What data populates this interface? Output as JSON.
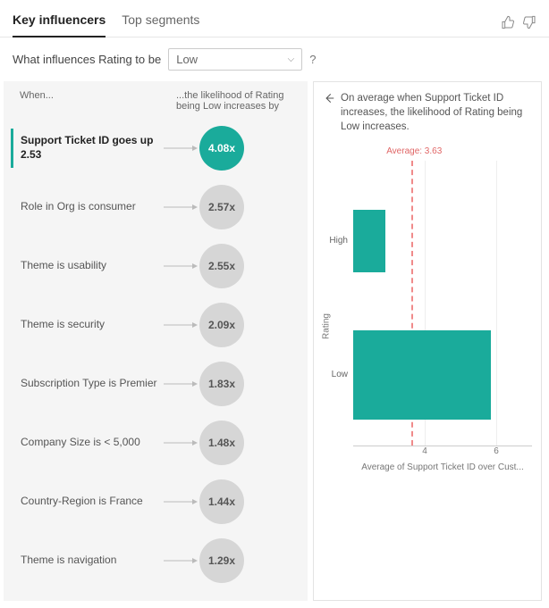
{
  "tabs": {
    "key_influencers": "Key influencers",
    "top_segments": "Top segments"
  },
  "question": {
    "prefix": "What influences Rating to be",
    "dropdown_value": "Low",
    "help": "?"
  },
  "influencers": {
    "when_header": "When...",
    "then_header": "...the likelihood of Rating being Low increases by",
    "items": [
      {
        "label": "Support Ticket ID goes up 2.53",
        "multiplier": "4.08x",
        "selected": true
      },
      {
        "label": "Role in Org is consumer",
        "multiplier": "2.57x",
        "selected": false
      },
      {
        "label": "Theme is usability",
        "multiplier": "2.55x",
        "selected": false
      },
      {
        "label": "Theme is security",
        "multiplier": "2.09x",
        "selected": false
      },
      {
        "label": "Subscription Type is Premier",
        "multiplier": "1.83x",
        "selected": false
      },
      {
        "label": "Company Size is < 5,000",
        "multiplier": "1.48x",
        "selected": false
      },
      {
        "label": "Country-Region is France",
        "multiplier": "1.44x",
        "selected": false
      },
      {
        "label": "Theme is navigation",
        "multiplier": "1.29x",
        "selected": false
      }
    ]
  },
  "detail": {
    "text": "On average when Support Ticket ID increases, the likelihood of Rating being Low increases.",
    "avg_label": "Average: 3.63"
  },
  "chart_data": {
    "type": "bar",
    "orientation": "horizontal",
    "title": "",
    "categories": [
      "High",
      "Low"
    ],
    "values": [
      2.9,
      5.85
    ],
    "average": 3.63,
    "xlabel": "Average of Support Ticket ID over Cust...",
    "ylabel": "Rating",
    "xlim": [
      2,
      7
    ],
    "xticks": [
      4,
      6
    ]
  }
}
